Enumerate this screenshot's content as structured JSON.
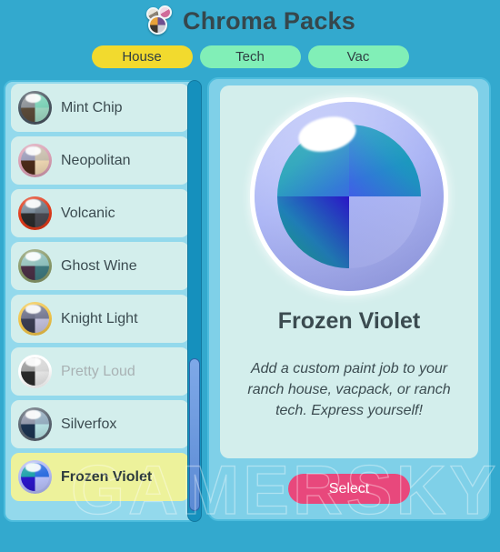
{
  "header": {
    "title": "Chroma Packs",
    "icon": "chroma-ball-cluster-icon"
  },
  "tabs": [
    {
      "label": "House",
      "active": true
    },
    {
      "label": "Tech",
      "active": false
    },
    {
      "label": "Vac",
      "active": false
    }
  ],
  "list": [
    {
      "label": "Mint Chip",
      "ring": "#4a5560",
      "q_tl": "#8a8f94",
      "q_tr": "#7fd2b8",
      "q_bl": "#5a4a38",
      "q_br": "#9fd8c2",
      "state": "normal"
    },
    {
      "label": "Neopolitan",
      "ring": "#d9a0b4",
      "q_tl": "#9a9bb8",
      "q_tr": "#c9bfae",
      "q_bl": "#4a2a18",
      "q_br": "#f0d9b4",
      "state": "normal"
    },
    {
      "label": "Volcanic",
      "ring": "#e03a1a",
      "q_tl": "#7a8a99",
      "q_tr": "#6d7a86",
      "q_bl": "#2b2b2b",
      "q_br": "#4a4a52",
      "state": "normal"
    },
    {
      "label": "Ghost Wine",
      "ring": "#8a9a6a",
      "q_tl": "#96c2bc",
      "q_tr": "#8fc0bd",
      "q_bl": "#4a2f45",
      "q_br": "#3f7a80",
      "state": "normal"
    },
    {
      "label": "Knight Light",
      "ring": "#f0c44a",
      "q_tl": "#6c6f88",
      "q_tr": "#7a7d96",
      "q_bl": "#3a3d52",
      "q_br": "#c4c2de",
      "state": "normal"
    },
    {
      "label": "Pretty Loud",
      "ring": "#ffffff",
      "q_tl": "#9a9a9a",
      "q_tr": "#d8d8d8",
      "q_bl": "#2a2a2a",
      "q_br": "#e8e8e8",
      "state": "disabled"
    },
    {
      "label": "Silverfox",
      "ring": "#5a6470",
      "q_tl": "#8f95a8",
      "q_tr": "#96aec0",
      "q_bl": "#1c3350",
      "q_br": "#b8e4e6",
      "state": "normal"
    },
    {
      "label": "Frozen Violet",
      "ring": "#b0b8f2",
      "q_tl": "#1aa0a8",
      "q_tr": "#2f6fe0",
      "q_bl": "#2a16c8",
      "q_br": "#b9c2fb",
      "state": "selected"
    }
  ],
  "detail": {
    "name": "Frozen Violet",
    "description": "Add a custom paint job to your ranch house, vacpack, or ranch tech. Express yourself!",
    "select_label": "Select"
  },
  "scrollbar": {
    "thumb_position": "near-bottom"
  },
  "watermark": {
    "text": "GAMERSKY"
  },
  "colors": {
    "background": "#33a9ce",
    "panel_light": "#d3eeec",
    "panel_mid": "#93d9ec",
    "panel_border": "#4cbcdd",
    "tab_active": "#f2da2e",
    "tab_inactive": "#81efb7",
    "row_selected": "#edf29b",
    "select_button": "#e8487c",
    "text_dark": "#3b4b50",
    "text_disabled": "#a9b2b4",
    "scrollbar_track": "#1590bd",
    "scrollbar_thumb": "#6f9de0"
  }
}
